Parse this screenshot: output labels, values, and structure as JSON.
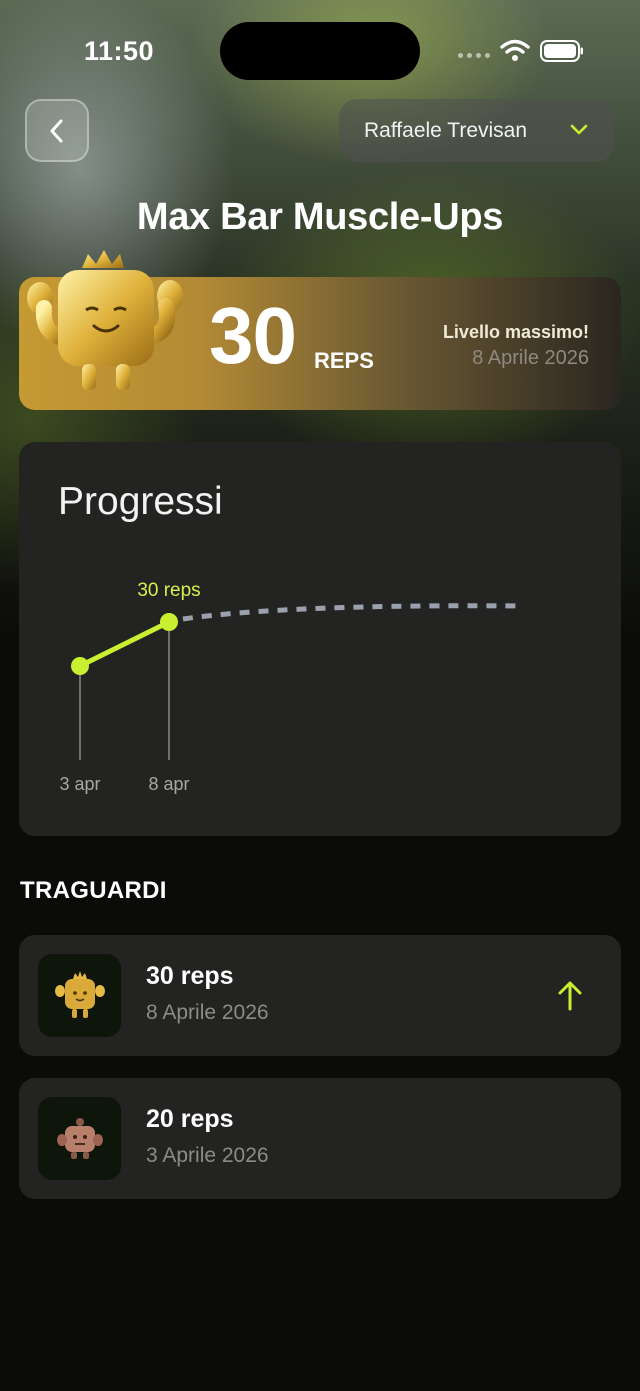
{
  "status_bar": {
    "time": "11:50"
  },
  "header": {
    "user_name": "Raffaele Trevisan",
    "title": "Max Bar Muscle-Ups"
  },
  "best": {
    "value": "30",
    "unit": "REPS",
    "label": "Livello massimo!",
    "date": "8 Aprile 2026"
  },
  "progress": {
    "title": "Progressi",
    "point_label": "30 reps"
  },
  "chart_data": {
    "type": "line",
    "x": [
      "3 apr",
      "8 apr"
    ],
    "series": [
      {
        "values": [
          20,
          30
        ]
      }
    ],
    "projection": "dashed-flat",
    "accent": "#c8f031"
  },
  "milestones": {
    "heading": "TRAGUARDI",
    "items": [
      {
        "value": "30 reps",
        "date": "8 Aprile 2026",
        "icon": "gold-mascot-icon",
        "trend": "arrow-up-icon"
      },
      {
        "value": "20 reps",
        "date": "3 Aprile 2026",
        "icon": "brown-mascot-icon"
      }
    ]
  },
  "colors": {
    "accent": "#c8f031",
    "card": "#232321",
    "gold": "#c59a33"
  }
}
